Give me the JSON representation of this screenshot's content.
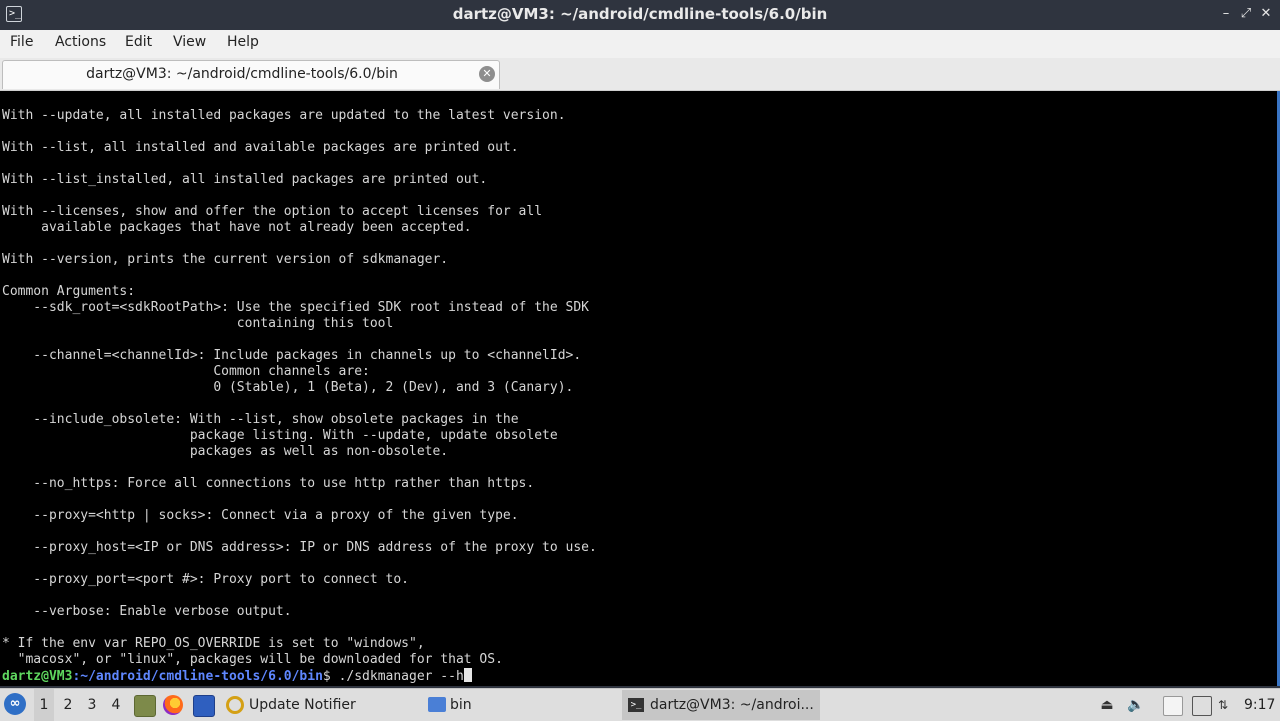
{
  "window": {
    "title": "dartz@VM3: ~/android/cmdline-tools/6.0/bin",
    "controls": [
      "minimize",
      "maximize",
      "close"
    ]
  },
  "menu": {
    "items": [
      "File",
      "Actions",
      "Edit",
      "View",
      "Help"
    ]
  },
  "tab": {
    "label": "dartz@VM3: ~/android/cmdline-tools/6.0/bin"
  },
  "terminal": {
    "lines": [
      "With --update, all installed packages are updated to the latest version.",
      "",
      "With --list, all installed and available packages are printed out.",
      "",
      "With --list_installed, all installed packages are printed out.",
      "",
      "With --licenses, show and offer the option to accept licenses for all",
      "     available packages that have not already been accepted.",
      "",
      "With --version, prints the current version of sdkmanager.",
      "",
      "Common Arguments:",
      "    --sdk_root=<sdkRootPath>: Use the specified SDK root instead of the SDK",
      "                              containing this tool",
      "",
      "    --channel=<channelId>: Include packages in channels up to <channelId>.",
      "                           Common channels are:",
      "                           0 (Stable), 1 (Beta), 2 (Dev), and 3 (Canary).",
      "",
      "    --include_obsolete: With --list, show obsolete packages in the",
      "                        package listing. With --update, update obsolete",
      "                        packages as well as non-obsolete.",
      "",
      "    --no_https: Force all connections to use http rather than https.",
      "",
      "    --proxy=<http | socks>: Connect via a proxy of the given type.",
      "",
      "    --proxy_host=<IP or DNS address>: IP or DNS address of the proxy to use.",
      "",
      "    --proxy_port=<port #>: Proxy port to connect to.",
      "",
      "    --verbose: Enable verbose output.",
      "",
      "* If the env var REPO_OS_OVERRIDE is set to \"windows\",",
      "  \"macosx\", or \"linux\", packages will be downloaded for that OS."
    ],
    "prompt": {
      "user_host": "dartz@VM3",
      "path": ":~/android/cmdline-tools/6.0/bin",
      "symbol": "$ ",
      "command": "./sdkmanager --h"
    }
  },
  "taskbar": {
    "workspaces": [
      "1",
      "2",
      "3",
      "4"
    ],
    "tasks": {
      "update_notifier": "Update Notifier",
      "files": "bin",
      "terminal": "dartz@VM3: ~/androi..."
    },
    "clock": "9:17"
  },
  "colors": {
    "terminal_bg": "#000000",
    "prompt_user": "#5fd75f",
    "prompt_path": "#5f87ff",
    "titlebar_bg": "#2f343f"
  }
}
